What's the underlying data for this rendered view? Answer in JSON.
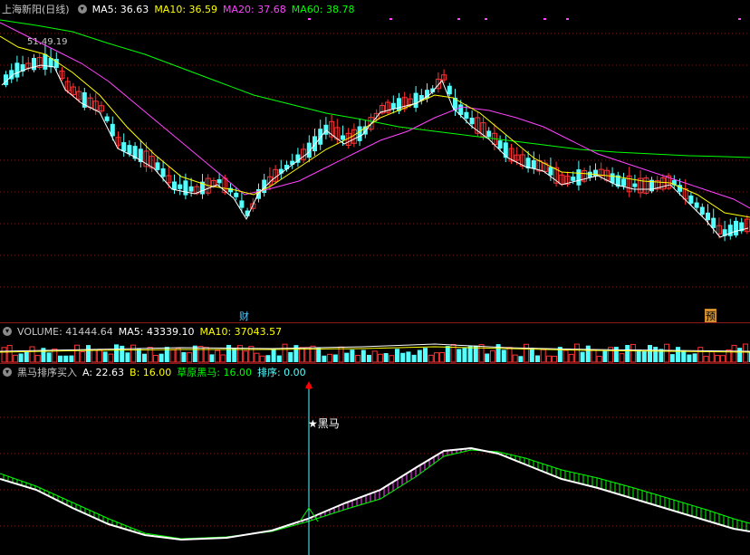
{
  "main": {
    "title": "上海新阳(日线)",
    "ma": [
      {
        "label": "MA5: 36.63",
        "color": "#ffffff"
      },
      {
        "label": "MA10: 36.59",
        "color": "#ffff00"
      },
      {
        "label": "MA20: 37.68",
        "color": "#ff44ff"
      },
      {
        "label": "MA60: 38.78",
        "color": "#00ff00"
      }
    ],
    "high_label": "51.49.19",
    "marker_cai": "财",
    "marker_yu": "预"
  },
  "volume": {
    "title": "VOLUME: 41444.64",
    "ma5": "MA5: 43339.10",
    "ma10": "MA10: 37043.57"
  },
  "indicator": {
    "title": "黑马排序买入",
    "a": "A: 22.63",
    "b": "B: 16.00",
    "c": "草原黑马: 16.00",
    "d": "排序: 0.00",
    "signal": "★黑马"
  },
  "colors": {
    "up": "#ff3333",
    "down": "#54ffff",
    "ma5": "#ffffff",
    "ma10": "#ffff00",
    "ma20": "#ff44ff",
    "ma60": "#00ff00",
    "grid": "#7a1a1a"
  }
}
